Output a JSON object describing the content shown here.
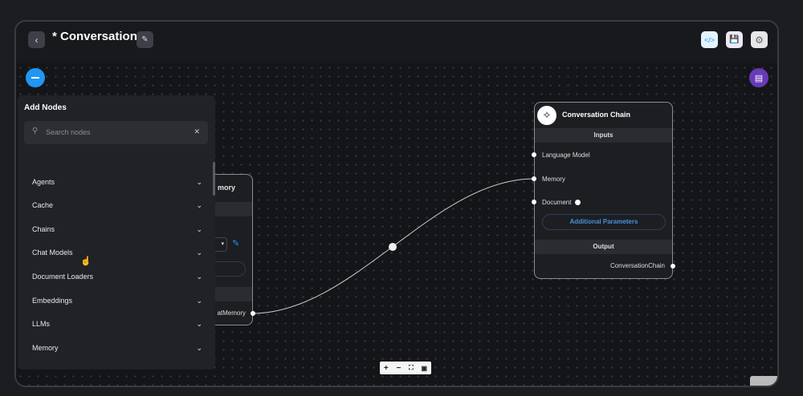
{
  "header": {
    "title": "* Conversation"
  },
  "add_nodes": {
    "title": "Add Nodes",
    "search_placeholder": "Search nodes",
    "categories": [
      "Agents",
      "Cache",
      "Chains",
      "Chat Models",
      "Document Loaders",
      "Embeddings",
      "LLMs",
      "Memory"
    ]
  },
  "memory_node": {
    "title_partial": "mory",
    "output_partial": "atMemory"
  },
  "chain_node": {
    "title": "Conversation Chain",
    "inputs_label": "Inputs",
    "inputs": [
      "Language Model",
      "Memory",
      "Document"
    ],
    "additional_params": "Additional Parameters",
    "output_label": "Output",
    "output": "ConversationChain"
  },
  "colors": {
    "accent_blue": "#2196f3",
    "chat_purple": "#673ab7"
  }
}
